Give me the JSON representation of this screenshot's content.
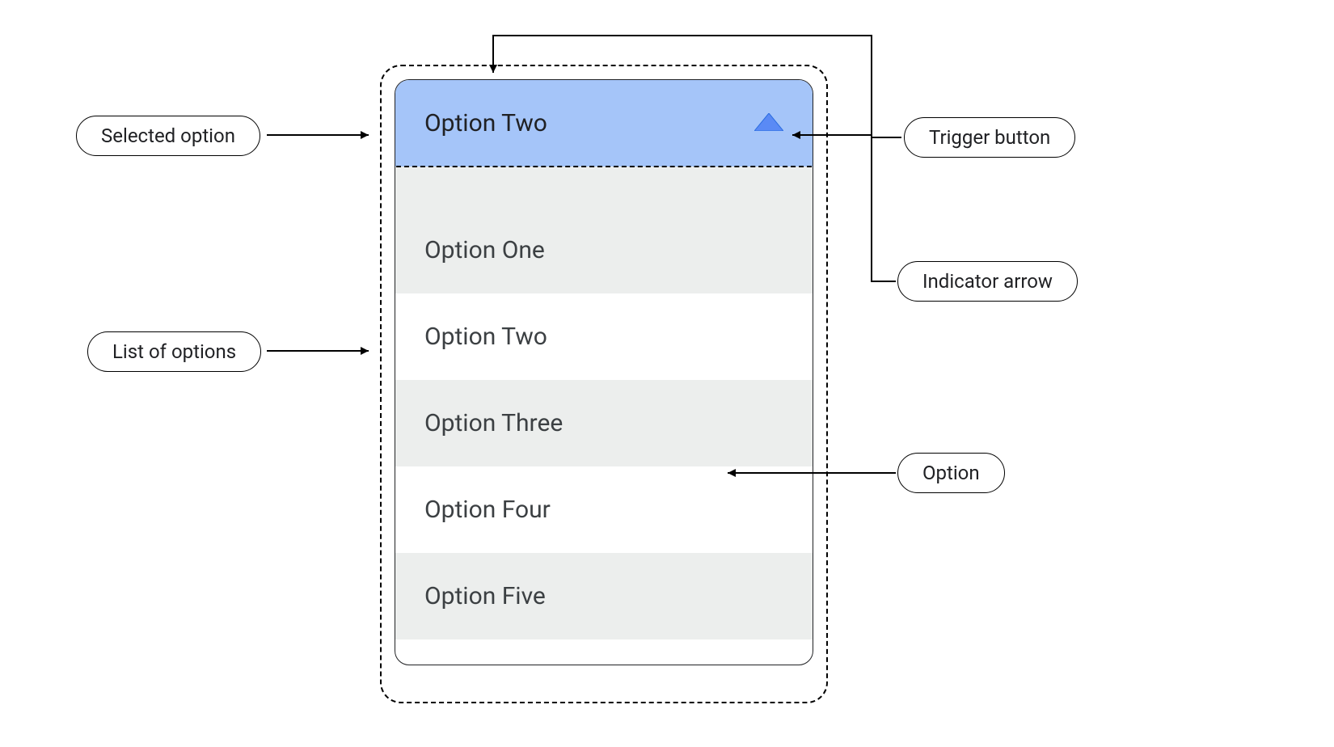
{
  "annotations": {
    "selected_option": "Selected option",
    "list_of_options": "List of options",
    "trigger_button": "Trigger button",
    "indicator_arrow": "Indicator arrow",
    "option": "Option"
  },
  "dropdown": {
    "selected_label": "Option Two",
    "options": [
      {
        "label": "Option One"
      },
      {
        "label": "Option Two"
      },
      {
        "label": "Option Three"
      },
      {
        "label": "Option  Four"
      },
      {
        "label": "Option Five"
      }
    ]
  },
  "colors": {
    "trigger_bg": "#a5c5f9",
    "option_alt_bg": "#eceeed",
    "indicator_fill": "#5a8af5"
  }
}
